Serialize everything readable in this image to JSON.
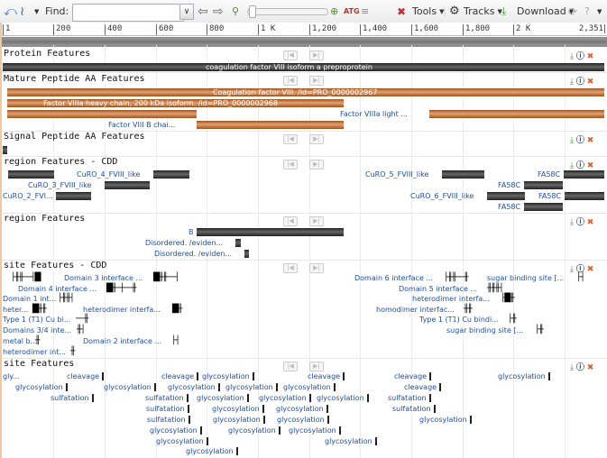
{
  "toolbar": {
    "find_label": "Find:",
    "find_value": "",
    "tools_label": "Tools",
    "tracks_label": "Tracks",
    "download_label": "Download",
    "icons": [
      "undo-icon",
      "sequence-icon",
      "back-arrow-icon",
      "forward-arrow-icon",
      "zoom-out-icon",
      "zoom-in-icon",
      "sequence-text-icon",
      "fit-icon",
      "tools-icon",
      "gear-icon",
      "download-icon",
      "refresh-icon",
      "help-icon"
    ]
  },
  "ruler": {
    "ticks": [
      "1",
      "200",
      "400",
      "600",
      "800",
      "1 K",
      "1,200",
      "1,400",
      "1,600",
      "1,800",
      "2 K",
      "2,351"
    ]
  },
  "tracks": [
    {
      "title": "Protein Features",
      "features": [
        {
          "label": "coagulation factor VIII isoform a preproprotein"
        }
      ]
    },
    {
      "title": "Mature Peptide AA Features",
      "features": [
        {
          "label": "Coagulation factor VIII. /id=PRO_0000002967"
        },
        {
          "label": "Factor VIIIa heavy chain, 200 kDa isoform. /id=PRO_0000002968"
        },
        {
          "label": "Factor VIIIa light ..."
        },
        {
          "label": "Factor VIII B chai..."
        }
      ]
    },
    {
      "title": "Signal Peptide AA Features",
      "features": []
    },
    {
      "title": "region Features - CDD",
      "features": [
        {
          "label": "CuRO_4_FVIII_like"
        },
        {
          "label": "CuRO_3_FVIII_like"
        },
        {
          "label": "CuRO_2_FVI..."
        },
        {
          "label": "CuRO_5_FVIII_like"
        },
        {
          "label": "FA58C"
        },
        {
          "label": "FA58C"
        },
        {
          "label": "CuRO_6_FVIII_like"
        },
        {
          "label": "FA58C"
        },
        {
          "label": "FA58C"
        }
      ]
    },
    {
      "title": "region Features",
      "features": [
        {
          "label": "B"
        },
        {
          "label": "Disordered. /eviden..."
        },
        {
          "label": "Disordered. /eviden..."
        }
      ]
    },
    {
      "title": "site Features - CDD",
      "features": [
        {
          "label": "Domain 3 interface ..."
        },
        {
          "label": "Domain 4 interface ..."
        },
        {
          "label": "Domain 1 int..."
        },
        {
          "label": "heter..."
        },
        {
          "label": "heterodimer interfa..."
        },
        {
          "label": "Type 1 (T1) Cu bi..."
        },
        {
          "label": "Domains 3/4 inte..."
        },
        {
          "label": "metal b..."
        },
        {
          "label": "Domain 2 interface ..."
        },
        {
          "label": "heterodimer int..."
        },
        {
          "label": "Domain 6 interface ..."
        },
        {
          "label": "sugar binding site [..."
        },
        {
          "label": "Domain 5 interface ..."
        },
        {
          "label": "heterodimer interfa..."
        },
        {
          "label": "homodimer interfac..."
        },
        {
          "label": "Type 1 (T1) Cu bindi..."
        },
        {
          "label": "sugar binding site [..."
        }
      ]
    },
    {
      "title": "site Features",
      "features": [
        {
          "label": "gly..."
        },
        {
          "label": "cleavage"
        },
        {
          "label": "cleavage"
        },
        {
          "label": "glycosylation"
        },
        {
          "label": "cleavage"
        },
        {
          "label": "cleavage"
        },
        {
          "label": "glycosylation"
        },
        {
          "label": "glycosylation"
        },
        {
          "label": "glycosylation"
        },
        {
          "label": "glycosylation"
        },
        {
          "label": "glycosylation"
        },
        {
          "label": "glycosylation"
        },
        {
          "label": "glycosylation"
        },
        {
          "label": "cleavage"
        },
        {
          "label": "sulfatation"
        },
        {
          "label": "sulfatation"
        },
        {
          "label": "glycosylation"
        },
        {
          "label": "glycosylation"
        },
        {
          "label": "glycosylation"
        },
        {
          "label": "sulfatation"
        },
        {
          "label": "sulfatation"
        },
        {
          "label": "glycosylation"
        },
        {
          "label": "glycosylation"
        },
        {
          "label": "glycosylation"
        },
        {
          "label": "sulfatation"
        },
        {
          "label": "sulfatation"
        },
        {
          "label": "glycosylation"
        },
        {
          "label": "glycosylation"
        },
        {
          "label": "glycosylation"
        },
        {
          "label": "glycosylation"
        },
        {
          "label": "glycosylation"
        },
        {
          "label": "glycosylation"
        },
        {
          "label": "glycosylation"
        },
        {
          "label": "glycosylation"
        },
        {
          "label": "glycosylation"
        }
      ]
    }
  ],
  "colors": {
    "protein_bar": "#333333",
    "mature_peptide_bar": "#c0703a",
    "feature_label": "#1f4fa0",
    "download_icon": "#3a9a2a",
    "info_icon": "#1e3a7a",
    "close_icon": "#d9622f"
  }
}
